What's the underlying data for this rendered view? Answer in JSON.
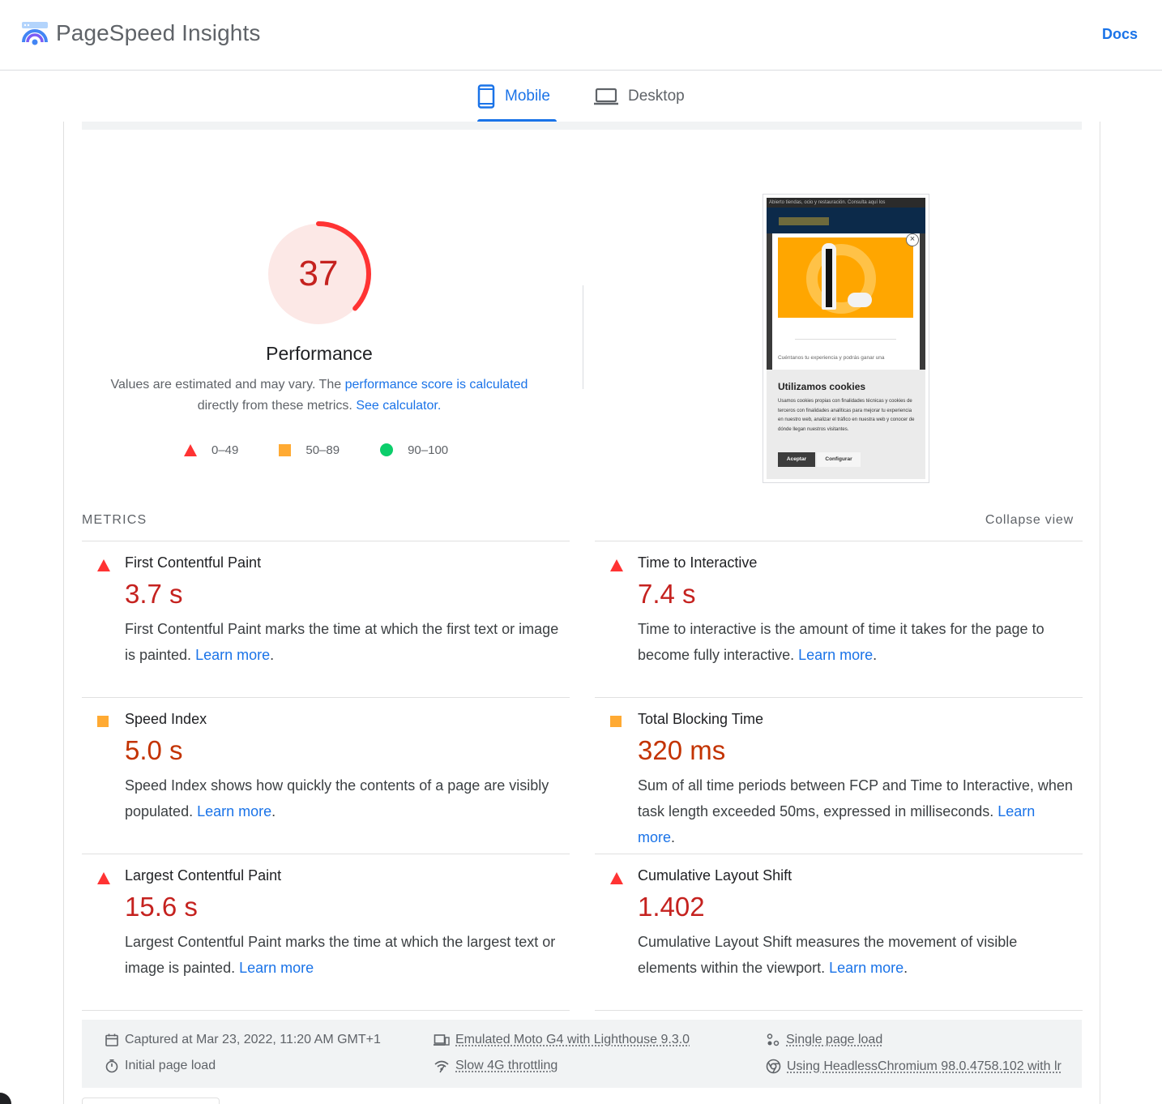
{
  "header": {
    "brand": "PageSpeed Insights",
    "docs_label": "Docs"
  },
  "tabs": [
    {
      "label": "Mobile",
      "icon": "smartphone-icon",
      "active": true
    },
    {
      "label": "Desktop",
      "icon": "laptop-icon",
      "active": false
    }
  ],
  "performance": {
    "score": "37",
    "score_value": 37,
    "title": "Performance",
    "desc_prefix": "Values are estimated and may vary. The ",
    "desc_link1": "performance score is calculated",
    "desc_middle": " directly from these metrics. ",
    "desc_link2": "See calculator."
  },
  "legend": [
    {
      "range": "0–49",
      "shape": "triangle",
      "color": "#ff3333"
    },
    {
      "range": "50–89",
      "shape": "square",
      "color": "#ffaa33"
    },
    {
      "range": "90–100",
      "shape": "circle",
      "color": "#0cce6b"
    }
  ],
  "screenshot": {
    "top_banner": "Abierto tiendas, ocio y restauración. Consulta aquí los",
    "tagline": "Cuéntanos tu experiencia y podrás ganar una",
    "cookie_title": "Utilizamos cookies",
    "cookie_text": "Usamos cookies propias con finalidades técnicas y cookies de terceros con finalidades analíticas para mejorar tu experiencia en nuestro web, analizar el tráfico en nuestra web y conocer de dónde llegan nuestros visitantes.",
    "accept_label": "Aceptar",
    "config_label": "Configurar"
  },
  "metrics_section": {
    "label": "METRICS",
    "collapse_label": "Collapse view"
  },
  "metrics": [
    {
      "name": "First Contentful Paint",
      "value": "3.7 s",
      "rating": "fail",
      "desc": "First Contentful Paint marks the time at which the first text or image is painted. ",
      "link": "Learn more",
      "suffix": "."
    },
    {
      "name": "Time to Interactive",
      "value": "7.4 s",
      "rating": "fail",
      "desc": "Time to interactive is the amount of time it takes for the page to become fully interactive. ",
      "link": "Learn more",
      "suffix": "."
    },
    {
      "name": "Speed Index",
      "value": "5.0 s",
      "rating": "average",
      "desc": "Speed Index shows how quickly the contents of a page are visibly populated. ",
      "link": "Learn more",
      "suffix": "."
    },
    {
      "name": "Total Blocking Time",
      "value": "320 ms",
      "rating": "average",
      "desc": "Sum of all time periods between FCP and Time to Interactive, when task length exceeded 50ms, expressed in milliseconds. ",
      "link": "Learn more",
      "suffix": "."
    },
    {
      "name": "Largest Contentful Paint",
      "value": "15.6 s",
      "rating": "fail",
      "desc": "Largest Contentful Paint marks the time at which the largest text or image is painted. ",
      "link": "Learn more",
      "suffix": ""
    },
    {
      "name": "Cumulative Layout Shift",
      "value": "1.402",
      "rating": "fail",
      "desc": "Cumulative Layout Shift measures the movement of visible elements within the viewport. ",
      "link": "Learn more",
      "suffix": "."
    }
  ],
  "info": {
    "captured": "Captured at Mar 23, 2022, 11:20 AM GMT+1",
    "initial": "Initial page load",
    "emulated": "Emulated Moto G4 with Lighthouse 9.3.0",
    "throttling": "Slow 4G throttling",
    "single": "Single page load",
    "browser": "Using HeadlessChromium 98.0.4758.102 with lr"
  },
  "colors": {
    "accent": "#1a73e8",
    "fail": "#ff3333",
    "average": "#ffaa33",
    "pass": "#0cce6b"
  }
}
